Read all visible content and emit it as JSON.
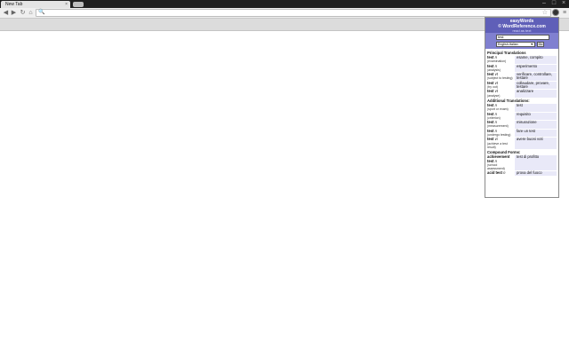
{
  "browser": {
    "tab_title": "New Tab",
    "tab_close": "×",
    "window_buttons": [
      "–",
      "□",
      "×"
    ],
    "nav": {
      "back": "◀",
      "forward": "▶",
      "reload": "↻",
      "home": "⌂"
    },
    "omnibox": {
      "value": "",
      "search_glyph": "🔍"
    },
    "star_glyph": "☆",
    "wrench_glyph": "≡"
  },
  "popup": {
    "title1": "easyWords",
    "title2": "© WordReference.com",
    "subtitle": "read as text",
    "search": {
      "value": "test",
      "language": "English-Italian",
      "go_label": "Go"
    },
    "sections": [
      {
        "heading": "Principal Translations",
        "rows": [
          {
            "term": "test",
            "pos": "n",
            "ctx": "(examination)",
            "translation": "esame, compito"
          },
          {
            "term": "test",
            "pos": "n",
            "ctx": "(analysis)",
            "translation": "esperimento"
          },
          {
            "term": "test",
            "pos": "vt",
            "ctx": "(subject to testing)",
            "translation": "verificare, controllare, testare"
          },
          {
            "term": "test",
            "pos": "vt",
            "ctx": "(try out)",
            "translation": "collaudare, provare, testare"
          },
          {
            "term": "test",
            "pos": "vt",
            "ctx": "(analyse)",
            "translation": "analizzare"
          }
        ]
      },
      {
        "heading": "Additional Translations:",
        "rows": [
          {
            "term": "test",
            "pos": "n",
            "ctx": "(sport or exam)",
            "translation": "test"
          },
          {
            "term": "test",
            "pos": "n",
            "ctx": "(criterion)",
            "translation": "requisito"
          },
          {
            "term": "test",
            "pos": "n",
            "ctx": "(measurement)",
            "translation": "misurazione"
          },
          {
            "term": "test",
            "pos": "n",
            "ctx": "(undergo testing)",
            "translation": "fare un test"
          },
          {
            "term": "test",
            "pos": "vi",
            "ctx": "(achieve a test result)",
            "translation": "avere buoni voti"
          }
        ]
      },
      {
        "heading": "Compound Forms:",
        "rows": [
          {
            "term": "achievement test",
            "pos": "n",
            "ctx": "(school assessment)",
            "translation": "test di profitto"
          },
          {
            "term": "acid test",
            "pos": "n",
            "ctx": "",
            "translation": "prova del fuoco"
          }
        ]
      }
    ]
  }
}
